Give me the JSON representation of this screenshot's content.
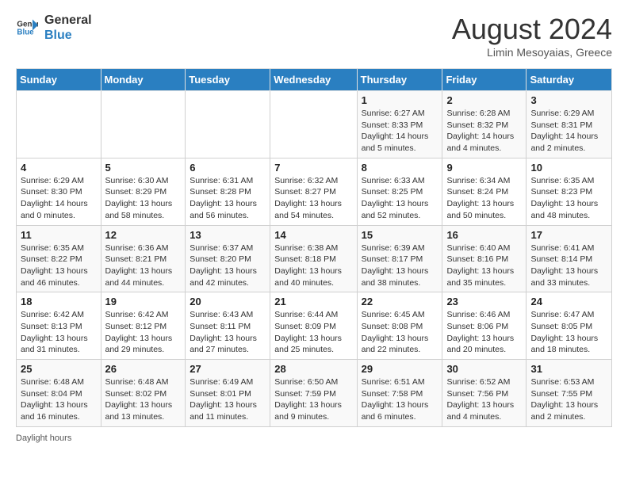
{
  "logo": {
    "line1": "General",
    "line2": "Blue"
  },
  "title": "August 2024",
  "subtitle": "Limin Mesoyaias, Greece",
  "days_of_week": [
    "Sunday",
    "Monday",
    "Tuesday",
    "Wednesday",
    "Thursday",
    "Friday",
    "Saturday"
  ],
  "footer": "Daylight hours",
  "weeks": [
    [
      {
        "day": "",
        "info": ""
      },
      {
        "day": "",
        "info": ""
      },
      {
        "day": "",
        "info": ""
      },
      {
        "day": "",
        "info": ""
      },
      {
        "day": "1",
        "info": "Sunrise: 6:27 AM\nSunset: 8:33 PM\nDaylight: 14 hours and 5 minutes."
      },
      {
        "day": "2",
        "info": "Sunrise: 6:28 AM\nSunset: 8:32 PM\nDaylight: 14 hours and 4 minutes."
      },
      {
        "day": "3",
        "info": "Sunrise: 6:29 AM\nSunset: 8:31 PM\nDaylight: 14 hours and 2 minutes."
      }
    ],
    [
      {
        "day": "4",
        "info": "Sunrise: 6:29 AM\nSunset: 8:30 PM\nDaylight: 14 hours and 0 minutes."
      },
      {
        "day": "5",
        "info": "Sunrise: 6:30 AM\nSunset: 8:29 PM\nDaylight: 13 hours and 58 minutes."
      },
      {
        "day": "6",
        "info": "Sunrise: 6:31 AM\nSunset: 8:28 PM\nDaylight: 13 hours and 56 minutes."
      },
      {
        "day": "7",
        "info": "Sunrise: 6:32 AM\nSunset: 8:27 PM\nDaylight: 13 hours and 54 minutes."
      },
      {
        "day": "8",
        "info": "Sunrise: 6:33 AM\nSunset: 8:25 PM\nDaylight: 13 hours and 52 minutes."
      },
      {
        "day": "9",
        "info": "Sunrise: 6:34 AM\nSunset: 8:24 PM\nDaylight: 13 hours and 50 minutes."
      },
      {
        "day": "10",
        "info": "Sunrise: 6:35 AM\nSunset: 8:23 PM\nDaylight: 13 hours and 48 minutes."
      }
    ],
    [
      {
        "day": "11",
        "info": "Sunrise: 6:35 AM\nSunset: 8:22 PM\nDaylight: 13 hours and 46 minutes."
      },
      {
        "day": "12",
        "info": "Sunrise: 6:36 AM\nSunset: 8:21 PM\nDaylight: 13 hours and 44 minutes."
      },
      {
        "day": "13",
        "info": "Sunrise: 6:37 AM\nSunset: 8:20 PM\nDaylight: 13 hours and 42 minutes."
      },
      {
        "day": "14",
        "info": "Sunrise: 6:38 AM\nSunset: 8:18 PM\nDaylight: 13 hours and 40 minutes."
      },
      {
        "day": "15",
        "info": "Sunrise: 6:39 AM\nSunset: 8:17 PM\nDaylight: 13 hours and 38 minutes."
      },
      {
        "day": "16",
        "info": "Sunrise: 6:40 AM\nSunset: 8:16 PM\nDaylight: 13 hours and 35 minutes."
      },
      {
        "day": "17",
        "info": "Sunrise: 6:41 AM\nSunset: 8:14 PM\nDaylight: 13 hours and 33 minutes."
      }
    ],
    [
      {
        "day": "18",
        "info": "Sunrise: 6:42 AM\nSunset: 8:13 PM\nDaylight: 13 hours and 31 minutes."
      },
      {
        "day": "19",
        "info": "Sunrise: 6:42 AM\nSunset: 8:12 PM\nDaylight: 13 hours and 29 minutes."
      },
      {
        "day": "20",
        "info": "Sunrise: 6:43 AM\nSunset: 8:11 PM\nDaylight: 13 hours and 27 minutes."
      },
      {
        "day": "21",
        "info": "Sunrise: 6:44 AM\nSunset: 8:09 PM\nDaylight: 13 hours and 25 minutes."
      },
      {
        "day": "22",
        "info": "Sunrise: 6:45 AM\nSunset: 8:08 PM\nDaylight: 13 hours and 22 minutes."
      },
      {
        "day": "23",
        "info": "Sunrise: 6:46 AM\nSunset: 8:06 PM\nDaylight: 13 hours and 20 minutes."
      },
      {
        "day": "24",
        "info": "Sunrise: 6:47 AM\nSunset: 8:05 PM\nDaylight: 13 hours and 18 minutes."
      }
    ],
    [
      {
        "day": "25",
        "info": "Sunrise: 6:48 AM\nSunset: 8:04 PM\nDaylight: 13 hours and 16 minutes."
      },
      {
        "day": "26",
        "info": "Sunrise: 6:48 AM\nSunset: 8:02 PM\nDaylight: 13 hours and 13 minutes."
      },
      {
        "day": "27",
        "info": "Sunrise: 6:49 AM\nSunset: 8:01 PM\nDaylight: 13 hours and 11 minutes."
      },
      {
        "day": "28",
        "info": "Sunrise: 6:50 AM\nSunset: 7:59 PM\nDaylight: 13 hours and 9 minutes."
      },
      {
        "day": "29",
        "info": "Sunrise: 6:51 AM\nSunset: 7:58 PM\nDaylight: 13 hours and 6 minutes."
      },
      {
        "day": "30",
        "info": "Sunrise: 6:52 AM\nSunset: 7:56 PM\nDaylight: 13 hours and 4 minutes."
      },
      {
        "day": "31",
        "info": "Sunrise: 6:53 AM\nSunset: 7:55 PM\nDaylight: 13 hours and 2 minutes."
      }
    ]
  ]
}
